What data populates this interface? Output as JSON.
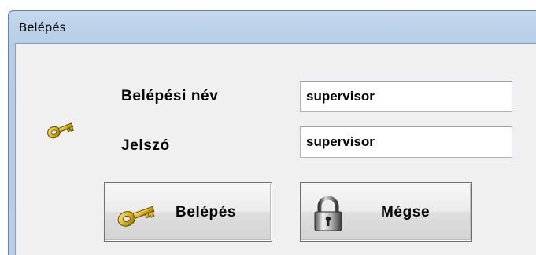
{
  "window": {
    "title": "Belépés"
  },
  "form": {
    "username_label": "Belépési név",
    "username_value": "supervisor",
    "password_label": "Jelszó",
    "password_value": "supervisor"
  },
  "buttons": {
    "login_label": "Belépés",
    "cancel_label": "Mégse"
  },
  "icons": {
    "form_icon": "key-icon",
    "login_icon": "key-icon",
    "cancel_icon": "padlock-icon"
  }
}
